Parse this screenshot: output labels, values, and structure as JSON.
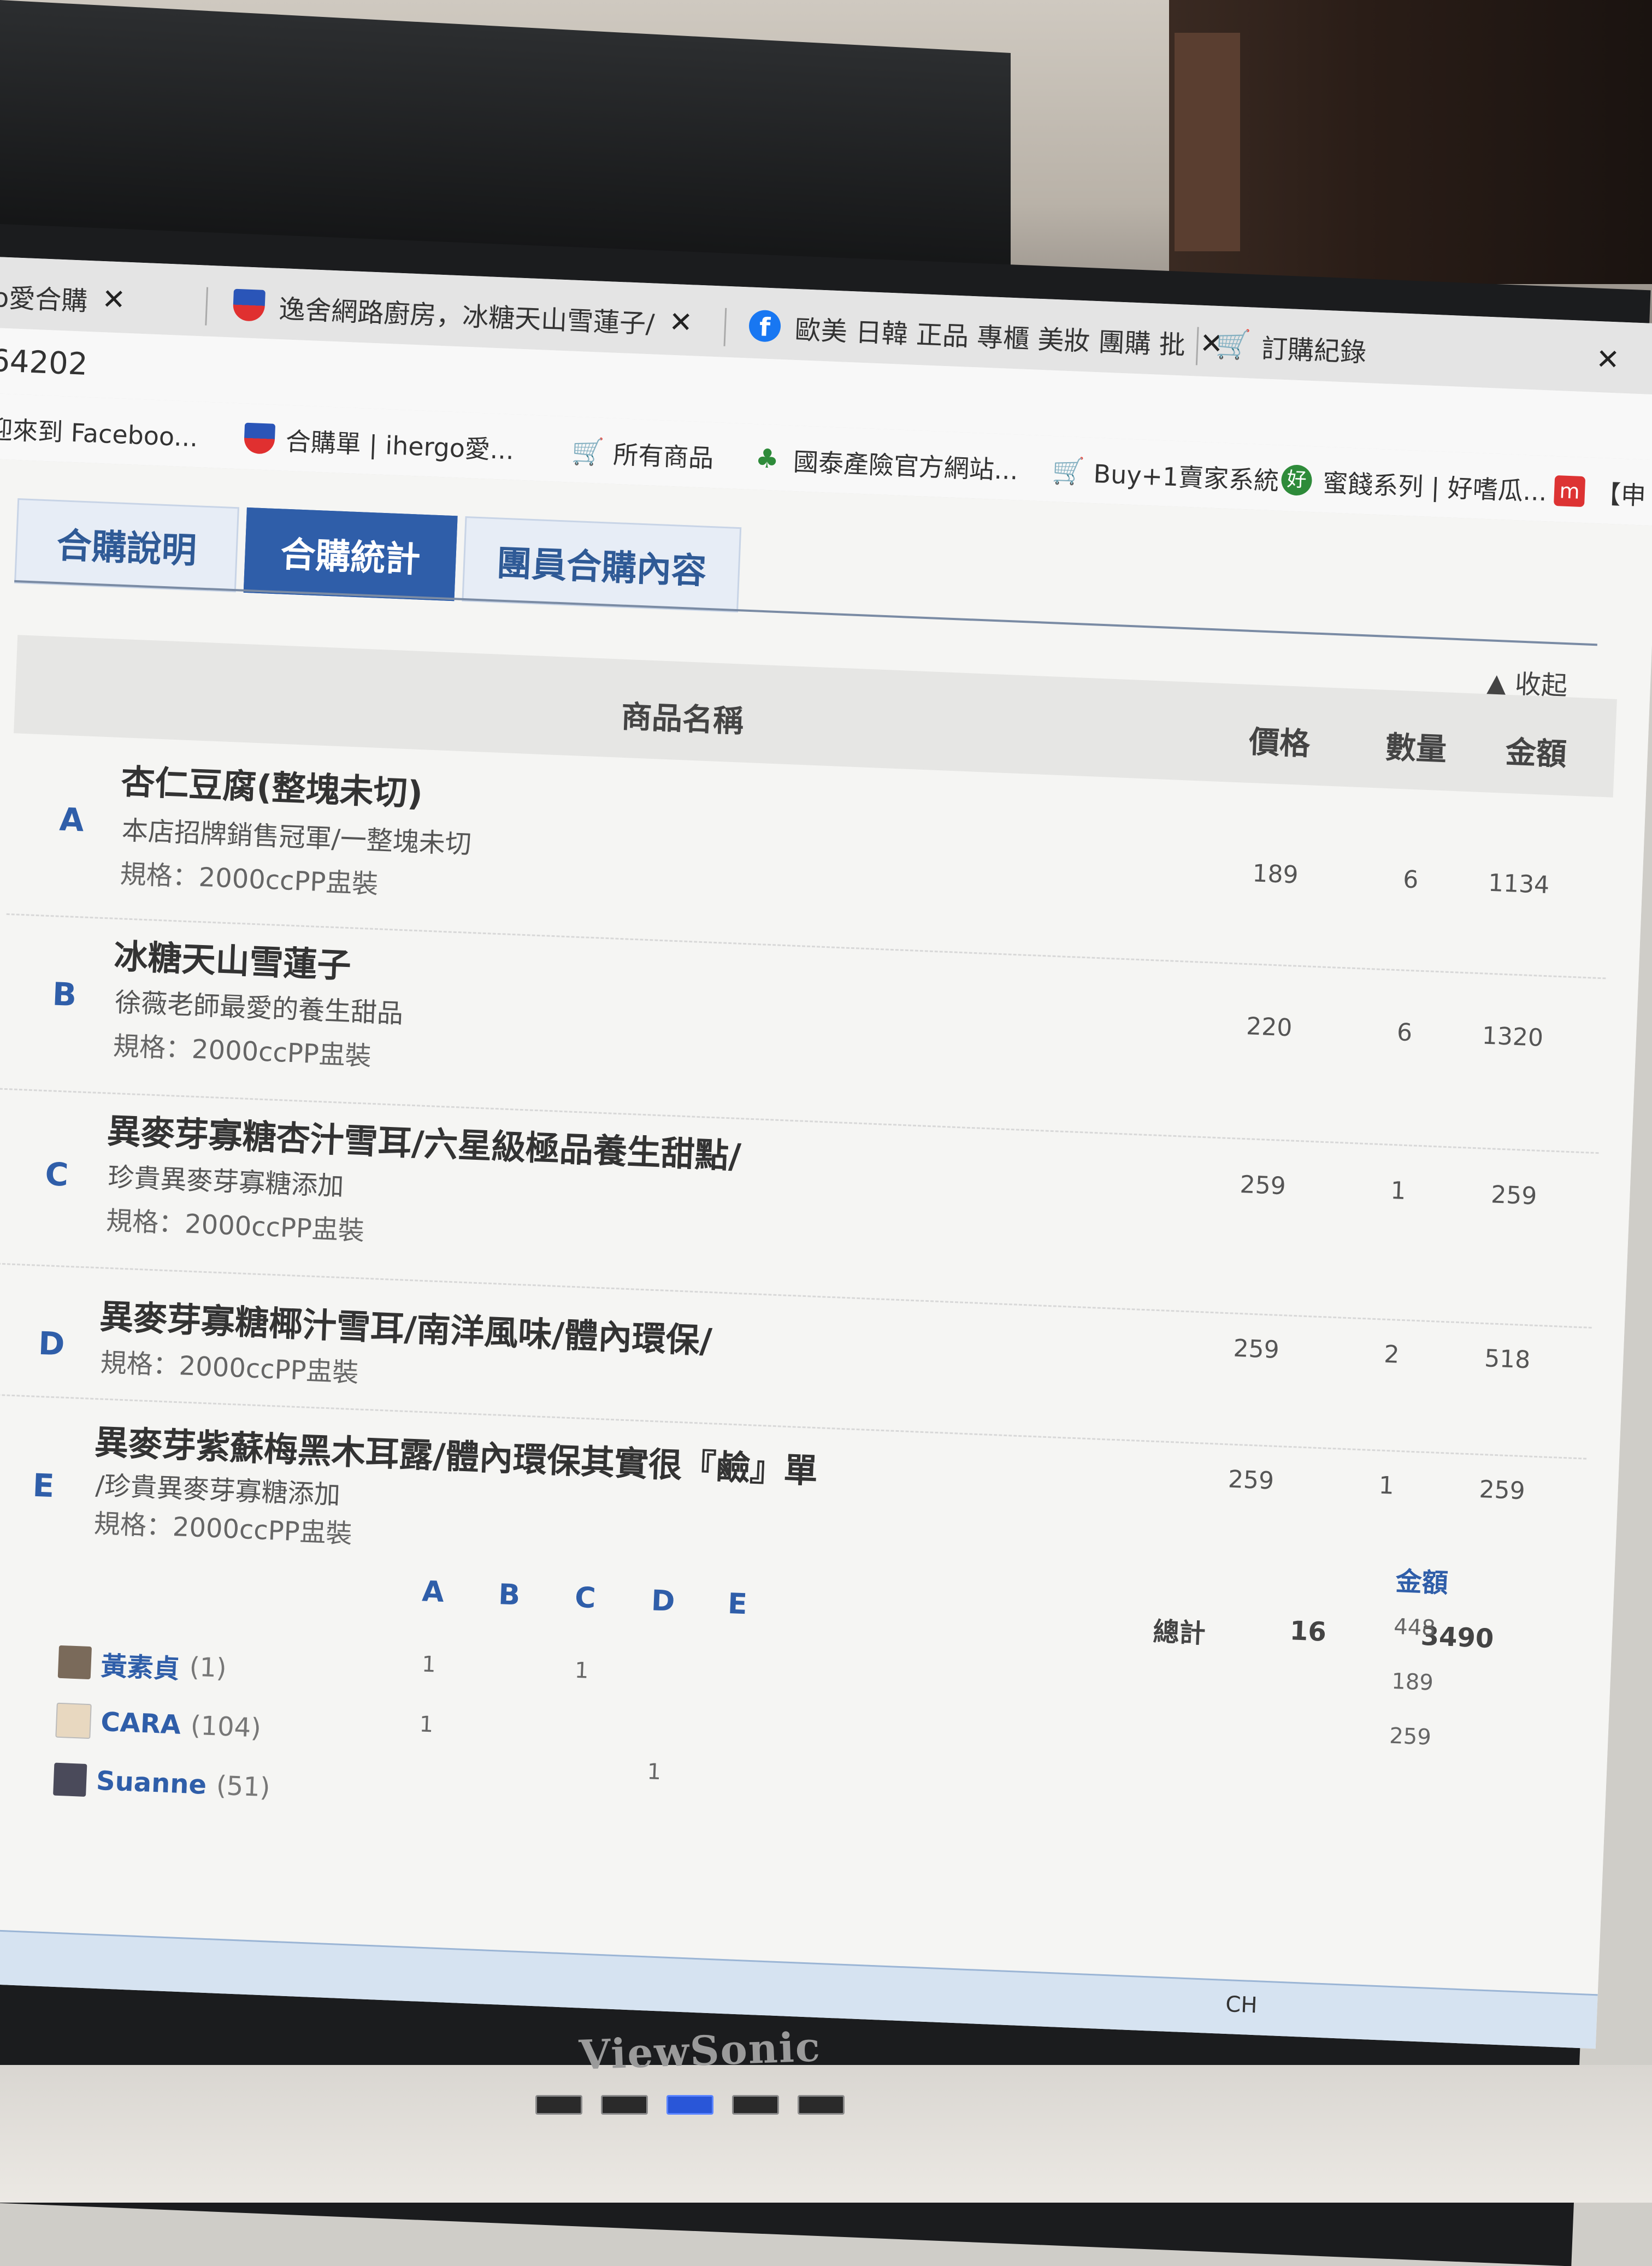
{
  "browser": {
    "tabs": [
      {
        "label": "o愛合購",
        "close": "✕"
      },
      {
        "label": "逸舍網路廚房，冰糖天山雪蓮子/",
        "close": "✕"
      },
      {
        "label": "歐美 日韓 正品 專櫃 美妝 團購 批",
        "close": "✕"
      },
      {
        "label": "訂購紀錄",
        "close": "✕"
      }
    ],
    "address": "64202",
    "bookmarks": [
      {
        "label": "迎來到 Faceboo..."
      },
      {
        "label": "合購單 | ihergo愛..."
      },
      {
        "label": "所有商品"
      },
      {
        "label": "國泰產險官方網站..."
      },
      {
        "label": "Buy+1賣家系統"
      },
      {
        "label": "蜜餞系列 | 好嗜瓜..."
      },
      {
        "label": "【申"
      }
    ]
  },
  "page": {
    "tabs": [
      "合購說明",
      "合購統計",
      "團員合購內容"
    ],
    "active_tab": "合購統計",
    "collapse_label": "▲ 收起",
    "table": {
      "headers": {
        "name": "商品名稱",
        "price": "價格",
        "qty": "數量",
        "amount": "金額"
      },
      "rows": [
        {
          "letter": "A",
          "name": "杏仁豆腐(整塊未切)",
          "desc": "本店招牌銷售冠軍/一整塊未切",
          "spec": "規格：2000ccPP盅裝",
          "price": "189",
          "qty": "6",
          "amount": "1134"
        },
        {
          "letter": "B",
          "name": "冰糖天山雪蓮子",
          "desc": "徐薇老師最愛的養生甜品",
          "spec": "規格：2000ccPP盅裝",
          "price": "220",
          "qty": "6",
          "amount": "1320"
        },
        {
          "letter": "C",
          "name": "異麥芽寡糖杏汁雪耳/六星級極品養生甜點/",
          "desc": "珍貴異麥芽寡糖添加",
          "spec": "規格：2000ccPP盅裝",
          "price": "259",
          "qty": "1",
          "amount": "259"
        },
        {
          "letter": "D",
          "name": "異麥芽寡糖椰汁雪耳/南洋風味/體內環保/",
          "desc": "",
          "spec": "規格：2000ccPP盅裝",
          "price": "259",
          "qty": "2",
          "amount": "518"
        },
        {
          "letter": "E",
          "name": "異麥芽紫蘇梅黑木耳露/體內環保其實很『鹼』單",
          "desc": "/珍貴異麥芽寡糖添加",
          "spec": "規格：2000ccPP盅裝",
          "price": "259",
          "qty": "1",
          "amount": "259"
        }
      ],
      "total_label": "總計",
      "total_qty": "16",
      "total_amount": "3490"
    },
    "members": {
      "columns": [
        "A",
        "B",
        "C",
        "D",
        "E"
      ],
      "amount_header": "金額",
      "amounts": [
        "448",
        "189",
        "259"
      ],
      "rows": [
        {
          "name": "黃素貞",
          "count": "(1)",
          "qtys": [
            "1",
            "",
            "1",
            "",
            ""
          ]
        },
        {
          "name": "CARA",
          "count": "(104)",
          "qtys": [
            "1",
            "",
            "",
            "",
            ""
          ]
        },
        {
          "name": "Suanne",
          "count": "(51)",
          "qtys": [
            "",
            "",
            "1",
            "",
            ""
          ]
        }
      ]
    }
  },
  "taskbar": {
    "tray": "CH"
  },
  "monitor": {
    "brand": "ViewSonic"
  }
}
